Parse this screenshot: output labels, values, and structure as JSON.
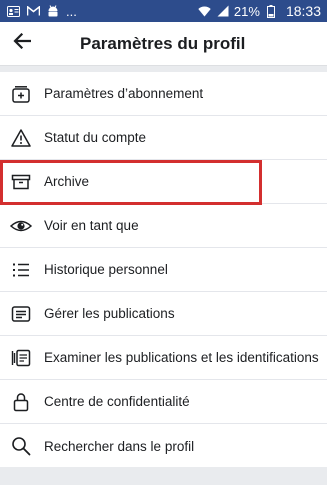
{
  "status_bar": {
    "battery_percent": "21%",
    "time": "18:33",
    "left_icons": [
      "contact-card-icon",
      "gmail-icon",
      "android-icon",
      "more-dots-icon"
    ],
    "right_icons": [
      "wifi-icon",
      "signal-icon",
      "battery-icon"
    ]
  },
  "header": {
    "title": "Paramètres du profil",
    "back_icon": "arrow-left-icon"
  },
  "colors": {
    "status_bar": "#2d4c8c",
    "highlight": "#d32f2f",
    "separator": "#e9ebee"
  },
  "menu": {
    "items": [
      {
        "label": "Paramètres d’abonnement",
        "icon": "subscription-icon"
      },
      {
        "label": "Statut du compte",
        "icon": "warning-icon"
      },
      {
        "label": "Archive",
        "icon": "archive-box-icon"
      },
      {
        "label": "Voir en tant que",
        "icon": "eye-icon"
      },
      {
        "label": "Historique personnel",
        "icon": "activity-list-icon"
      },
      {
        "label": "Gérer les publications",
        "icon": "manage-posts-icon"
      },
      {
        "label": "Examiner les publications et les identifications",
        "icon": "review-tags-icon"
      },
      {
        "label": "Centre de confidentialité",
        "icon": "lock-icon"
      },
      {
        "label": "Rechercher dans le profil",
        "icon": "search-icon"
      }
    ]
  }
}
